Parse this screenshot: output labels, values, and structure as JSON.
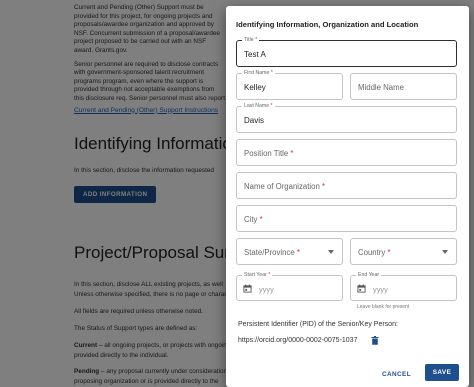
{
  "background": {
    "paragraph_1": "Current and Pending (Other) Support must be provided for this project, for ongoing projects and proposals/awardee organization and approved by NSF. Concurrent submission of a proposal/awardee project proposed to be carried out with an NSF award. Grants.gov.",
    "paragraph_2": "Senior personnel are required to disclose contracts with government-sponsored talent recruitment programs program, even where the support is provided through not acceptable exemptions from this disclosure req. Senior personnel must also report",
    "link": "Current and Pending (Other) Support Instructions",
    "section_1_heading": "Identifying Information",
    "section_1_text": "In this section, disclose the information requested",
    "add_information_button": "ADD INFORMATION",
    "section_2_heading": "Project/Proposal Summary",
    "section_2_text_1": "In this section, disclose ALL existing projects, as well",
    "section_2_text_2": "Unless otherwise specified, there is no page or character",
    "section_2_text_3": "All fields are required unless otherwise noted.",
    "section_2_text_4": "The Status of Support types are defined as:",
    "current_term": "Current",
    "current_def": " – all ongoing projects, or projects with ongoing",
    "current_def_2": "provided directly to the individual.",
    "pending_term": "Pending",
    "pending_def": " – any proposal currently under consideration",
    "pending_def_2": "proposing organization or is provided directly to the"
  },
  "dialog": {
    "title": "Identifying Information, Organization and Location",
    "fields": {
      "title": {
        "label": "Title",
        "required": "*",
        "value": "Test A"
      },
      "first_name": {
        "label": "First Name",
        "required": "*",
        "value": "Kelley"
      },
      "middle_name": {
        "placeholder": "Middle Name"
      },
      "last_name": {
        "label": "Last Name",
        "required": "*",
        "value": "Davis"
      },
      "position_title": {
        "placeholder": "Position Title",
        "required": "*"
      },
      "organization": {
        "placeholder": "Name of Organization",
        "required": "*"
      },
      "city": {
        "placeholder": "City",
        "required": "*"
      },
      "state": {
        "placeholder": "State/Province",
        "required": "*"
      },
      "country": {
        "placeholder": "Country",
        "required": "*"
      },
      "start_year": {
        "label": "Start Year",
        "required": "*",
        "placeholder": "yyyy"
      },
      "end_year": {
        "label": "End Year",
        "placeholder": "yyyy",
        "helper": "Leave blank for present"
      }
    },
    "pid_label": "Persistent Identifier (PID) of the Senior/Key Person:",
    "pid_value": "https://orcid.org/0000-0002-0075-1037",
    "cancel_label": "CANCEL",
    "save_label": "SAVE"
  },
  "colors": {
    "primary": "#1f4f8f",
    "required": "#d32f2f",
    "overlay": "rgba(0,0,0,0.5)"
  }
}
